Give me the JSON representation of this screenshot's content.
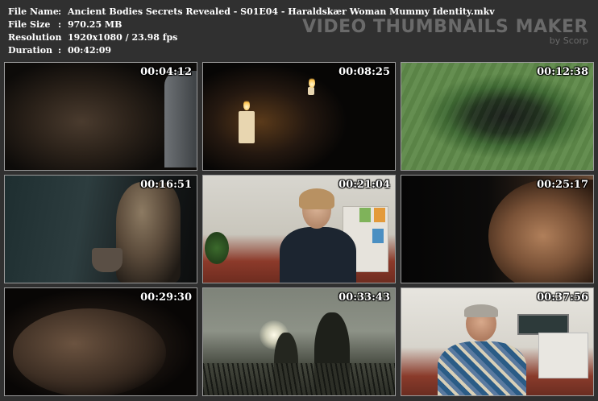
{
  "info": {
    "rows": [
      {
        "label": "File Name",
        "sep": ":",
        "value": "Ancient Bodies Secrets Revealed - S01E04 - Haraldskær Woman Mummy Identity.mkv"
      },
      {
        "label": "File Size",
        "sep": ":",
        "value": "970.25 MB"
      },
      {
        "label": "Resolution",
        "sep": ":",
        "value": "1920x1080 / 23.98 fps"
      },
      {
        "label": "Duration",
        "sep": ":",
        "value": "00:42:09"
      }
    ]
  },
  "brand": {
    "title": "VIDEO THUMBNAILS MAKER",
    "subtitle": "by Scorp"
  },
  "thumbnails": [
    {
      "timestamp": "00:04:12"
    },
    {
      "timestamp": "00:08:25"
    },
    {
      "timestamp": "00:12:38"
    },
    {
      "timestamp": "00:16:51"
    },
    {
      "timestamp": "00:21:04"
    },
    {
      "timestamp": "00:25:17"
    },
    {
      "timestamp": "00:29:30"
    },
    {
      "timestamp": "00:33:43"
    },
    {
      "timestamp": "00:37:56"
    }
  ]
}
